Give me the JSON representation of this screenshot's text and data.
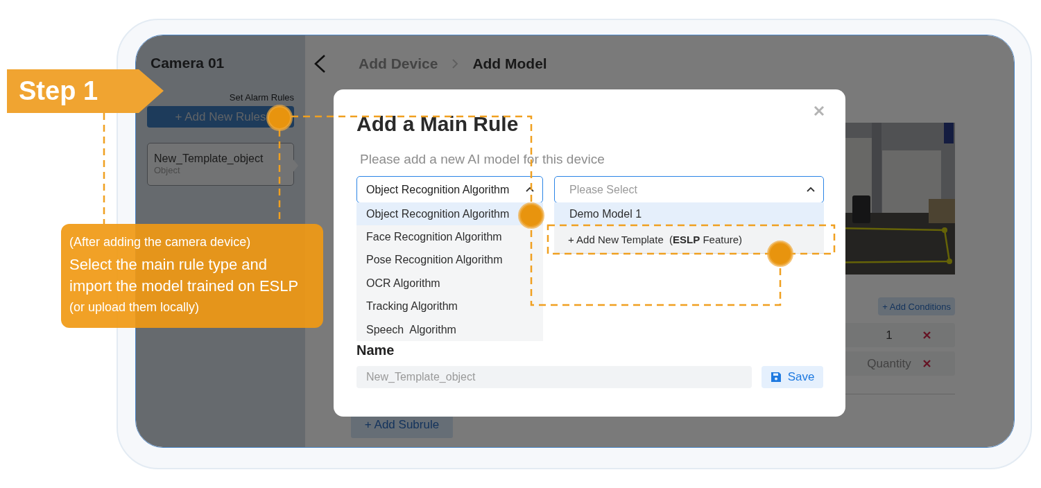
{
  "sidebar": {
    "title": "Camera 01",
    "section_label": "Set Alarm Rules",
    "add_button": "+ Add New Rules",
    "rules": [
      {
        "name": "New_Template_object",
        "type": "Object",
        "selected": true
      }
    ]
  },
  "header": {
    "breadcrumbs": [
      {
        "label": "Add Device",
        "current": false
      },
      {
        "label": "Add Model",
        "current": true
      }
    ]
  },
  "page": {
    "add_conditions": "+ Add Conditions",
    "conditions": [
      {
        "value": "1"
      },
      {
        "value": "Quantity"
      }
    ],
    "add_subrule": "+ Add Subrule"
  },
  "modal": {
    "title": "Add a Main Rule",
    "subtitle": "Please add a new AI model for this device",
    "algorithm_select": {
      "value": "Object Recognition Algorithm",
      "expanded": true,
      "options": [
        {
          "label": "Object Recognition Algorithm",
          "selected": true
        },
        {
          "label": "Face Recognition Algorithm",
          "selected": false
        },
        {
          "label": "Pose Recognition Algorithm",
          "selected": false
        },
        {
          "label": "OCR Algorithm",
          "selected": false
        },
        {
          "label": "Tracking Algorithm",
          "selected": false
        },
        {
          "label": "Speech  Algorithm",
          "selected": false
        }
      ]
    },
    "model_select": {
      "placeholder": "Please Select",
      "expanded": true,
      "options": [
        {
          "label": "Demo Model 1",
          "kind": "option",
          "selected": true
        },
        {
          "label": "+ Add New Template  (**ESLP** Feature)",
          "kind": "action",
          "selected": false
        }
      ]
    },
    "name_label": "Name",
    "name_field": {
      "placeholder": "New_Template_object"
    },
    "save_button": "Save"
  },
  "annotation": {
    "step": "Step 1",
    "note": "(After adding the camera device)",
    "main": "Select the main rule type and import the model trained on ESLP",
    "aside": "(or upload them locally)"
  }
}
